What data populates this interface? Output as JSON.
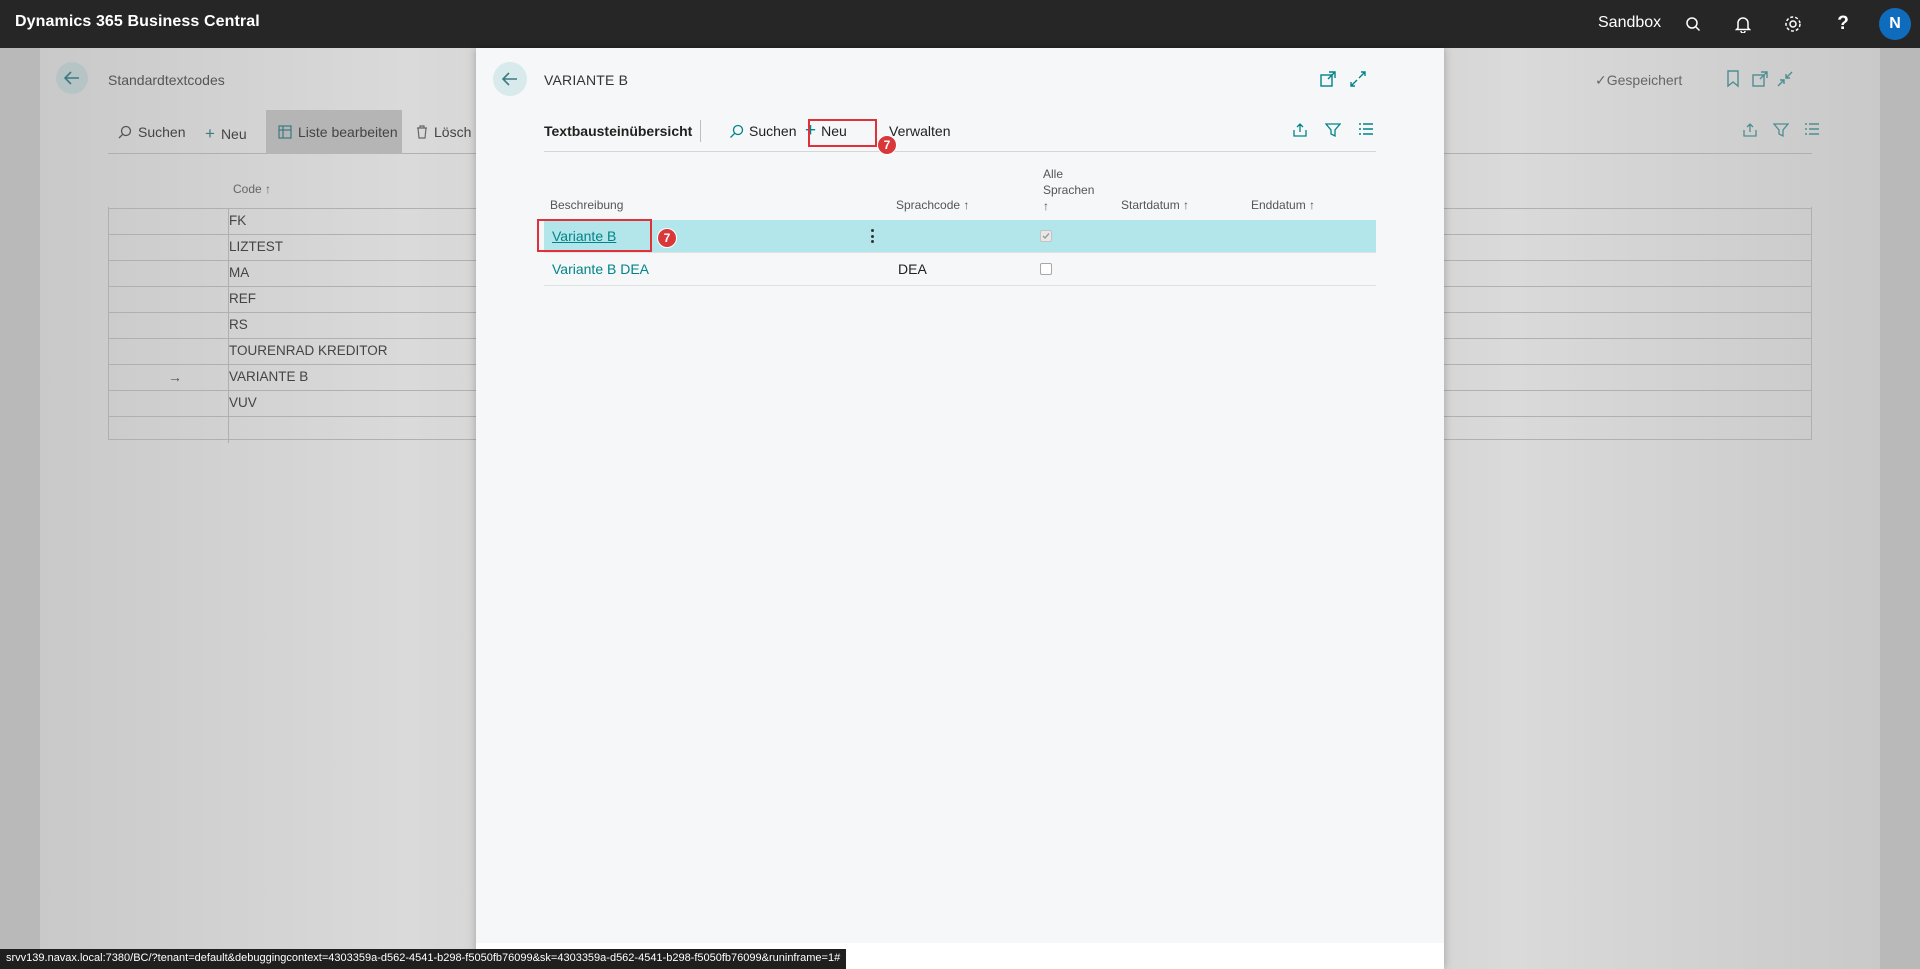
{
  "appbar": {
    "title": "Dynamics 365 Business Central",
    "environment": "Sandbox",
    "avatar_initial": "N",
    "icons": [
      "search-icon",
      "bell-icon",
      "gear-icon",
      "help-icon"
    ]
  },
  "background_page": {
    "title": "Standardtextcodes",
    "saved_label": "Gespeichert",
    "toolbar": {
      "search": "Suchen",
      "new": "Neu",
      "edit_list": "Liste bearbeiten",
      "delete": "Lösch"
    },
    "column_code": "Code",
    "sort_arrow": "↑",
    "current_row_marker": "→",
    "rows": [
      "FK",
      "LIZTEST",
      "MA",
      "REF",
      "RS",
      "TOURENRAD KREDITOR",
      "VARIANTE B",
      "VUV",
      ""
    ]
  },
  "dialog": {
    "title": "VARIANTE B",
    "toolbar": {
      "heading": "Textbausteinübersicht",
      "search": "Suchen",
      "new": "Neu",
      "manage": "Verwalten",
      "step_badge": "7"
    },
    "columns": {
      "description": "Beschreibung",
      "language_code": "Sprachcode",
      "all_languages_line1": "Alle",
      "all_languages_line2": "Sprachen",
      "start_date": "Startdatum",
      "end_date": "Enddatum",
      "sort_arrow": "↑"
    },
    "rows": [
      {
        "description": "Variante B",
        "language_code": "",
        "all_languages": true,
        "selected": true,
        "step_badge": "7"
      },
      {
        "description": "Variante B DEA",
        "language_code": "DEA",
        "all_languages": false,
        "selected": false
      }
    ]
  },
  "statusbar": {
    "url": "srvv139.navax.local:7380/BC/?tenant=default&debuggingcontext=4303359a-d562-4541-b298-f5050fb76099&sk=4303359a-d562-4541-b298-f5050fb76099&runinframe=1#"
  },
  "colors": {
    "accent": "#008489",
    "highlight": "#e0303a",
    "selected_row": "#b3e6ea",
    "appbar": "#262626",
    "avatar": "#0f6cbd"
  }
}
